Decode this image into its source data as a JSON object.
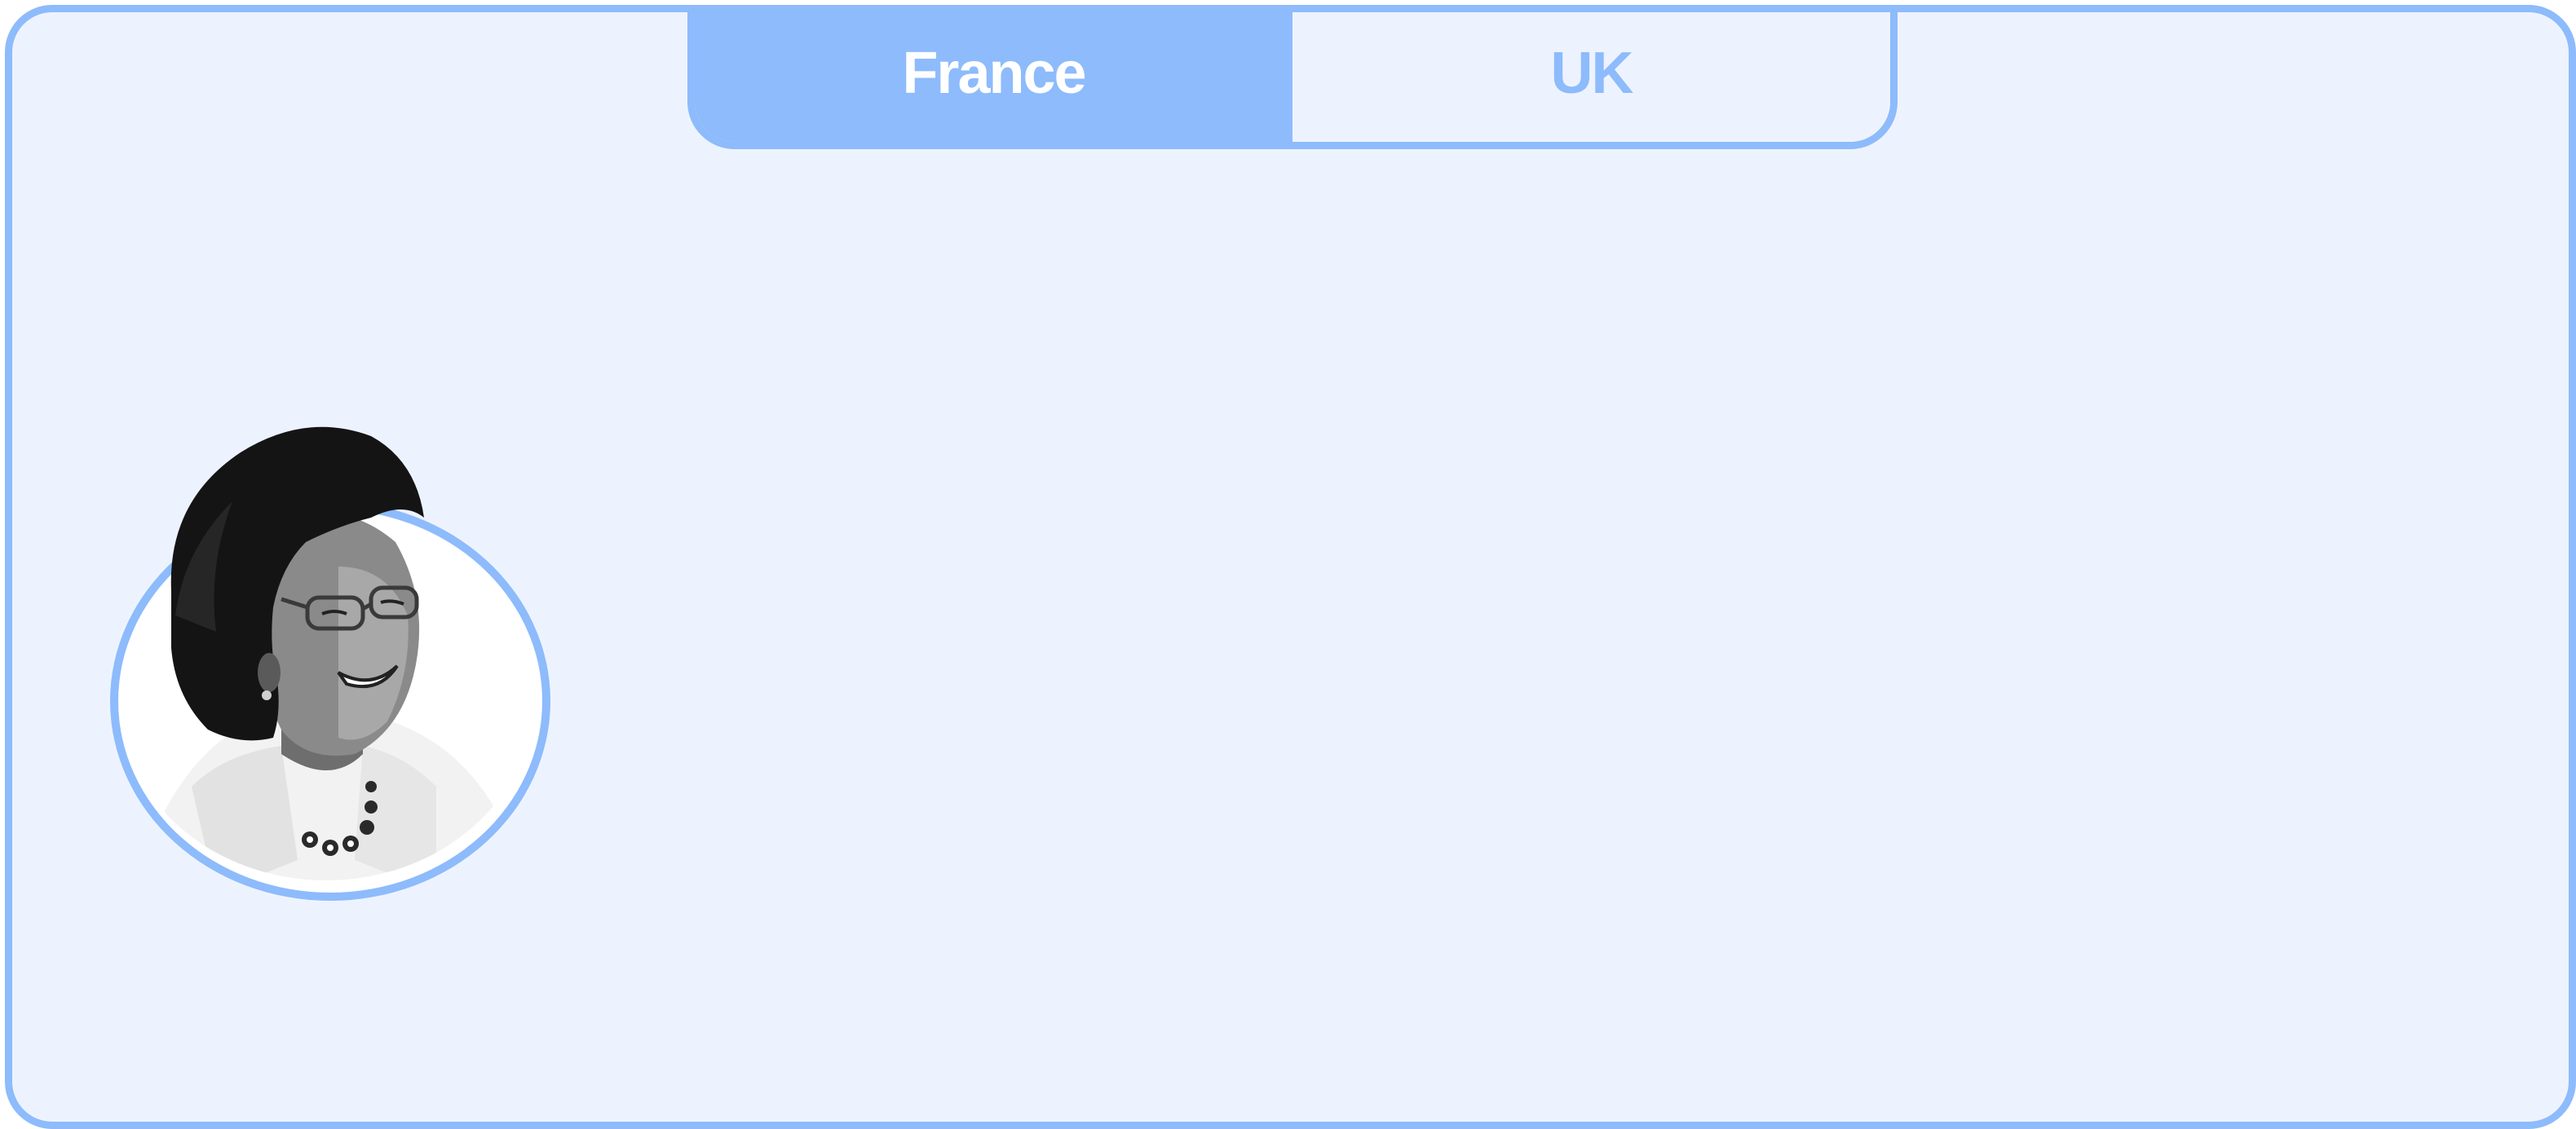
{
  "tabs": [
    {
      "label": "France",
      "active": true
    },
    {
      "label": "UK",
      "active": false
    }
  ],
  "colors": {
    "accent": "#8dbbfc",
    "background": "#edf3fe",
    "active_tab_text": "#ffffff"
  },
  "avatar": {
    "icon": "person-photo-icon"
  }
}
